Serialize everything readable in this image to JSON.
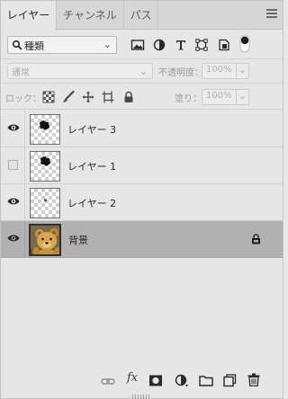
{
  "tabs": [
    {
      "label": "レイヤー",
      "active": true
    },
    {
      "label": "チャンネル",
      "active": false
    },
    {
      "label": "パス",
      "active": false
    }
  ],
  "filter": {
    "kind_label": "種類",
    "icons": [
      "image-filter-icon",
      "adjustment-filter-icon",
      "type-filter-icon",
      "shape-filter-icon",
      "smart-object-filter-icon",
      "filter-toggle-icon"
    ]
  },
  "blend": {
    "mode": "通常",
    "opacity_label": "不透明度：",
    "opacity_value": "100%"
  },
  "lock": {
    "label": "ロック：",
    "fill_label": "塗り：",
    "fill_value": "100%",
    "icons": [
      "lock-transparent-icon",
      "lock-image-icon",
      "lock-position-icon",
      "lock-artboard-icon",
      "lock-all-icon"
    ]
  },
  "layers": [
    {
      "name": "レイヤー 3",
      "visible": true,
      "selected": false,
      "locked": false
    },
    {
      "name": "レイヤー 1",
      "visible": false,
      "selected": false,
      "locked": false
    },
    {
      "name": "レイヤー 2",
      "visible": true,
      "selected": false,
      "locked": false
    },
    {
      "name": "背景",
      "visible": true,
      "selected": true,
      "locked": true
    }
  ],
  "bottom_toolbar": {
    "fx_label": "fx",
    "icons": [
      "link-layers-icon",
      "layer-style-icon",
      "add-mask-icon",
      "new-adjustment-layer-icon",
      "new-group-icon",
      "new-layer-icon",
      "delete-layer-icon"
    ]
  },
  "colors": {
    "panel_bg": "#e6e6e6",
    "tab_bar_bg": "#d6d6d6",
    "selected_row": "#b1b1b1",
    "text": "#2a2a2a",
    "dim_text": "#9a9a9a"
  }
}
